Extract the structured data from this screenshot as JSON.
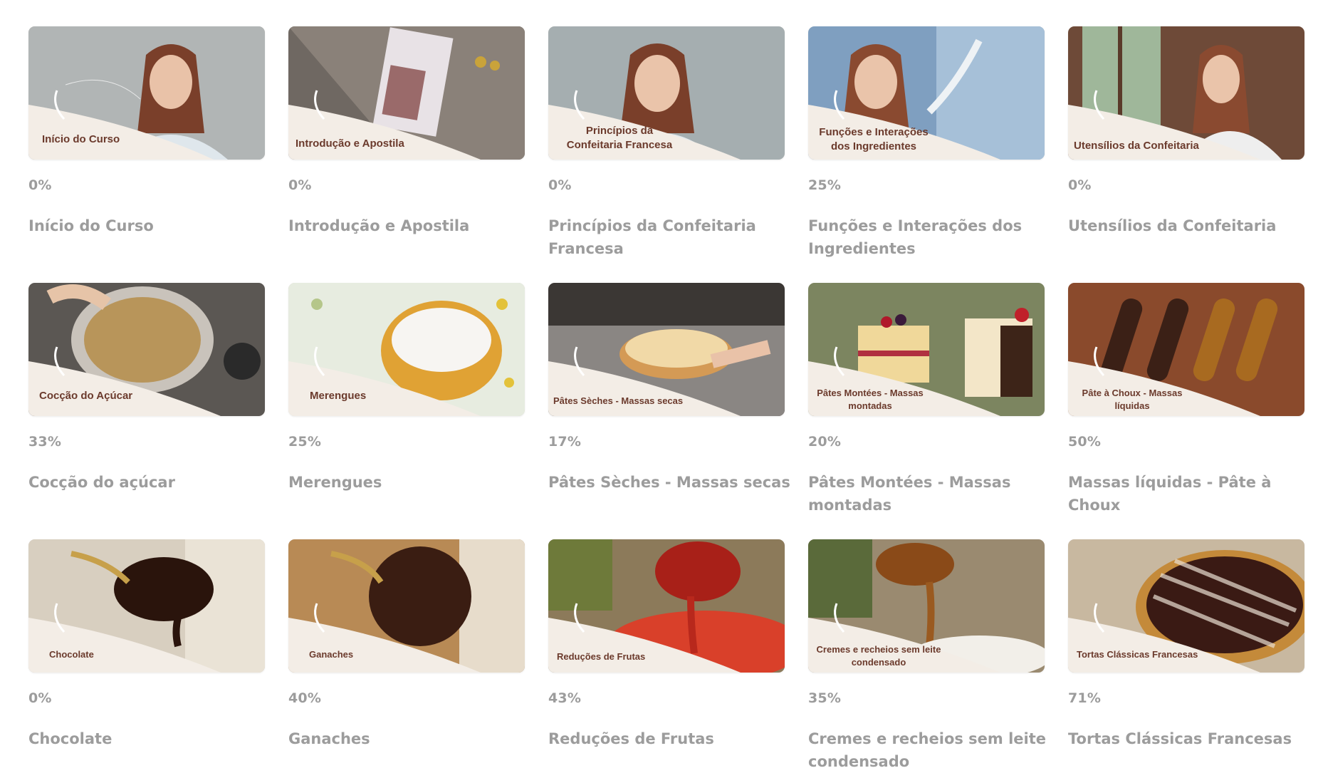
{
  "cards": [
    {
      "thumb_label": "Início do Curso",
      "percent": "0%",
      "title": "Início do Curso",
      "scene": "portrait-chef"
    },
    {
      "thumb_label": "Introdução e Apostila",
      "percent": "0%",
      "title": "Introdução e Apostila",
      "scene": "book"
    },
    {
      "thumb_label": "Princípios da\nConfeitaria Francesa",
      "percent": "0%",
      "title": "Princípios da Confeitaria Francesa",
      "scene": "portrait-chef"
    },
    {
      "thumb_label": "Funções e Interações\ndos Ingredientes",
      "percent": "25%",
      "title": "Funções e Interações dos Ingredientes",
      "scene": "chef-flour"
    },
    {
      "thumb_label": "Utensílios da Confeitaria",
      "percent": "0%",
      "title": "Utensílios da Confeitaria",
      "scene": "chef-window"
    },
    {
      "thumb_label": "Cocção do Açúcar",
      "percent": "33%",
      "title": "Cocção do açúcar",
      "scene": "sugar-pot"
    },
    {
      "thumb_label": "Merengues",
      "percent": "25%",
      "title": "Merengues",
      "scene": "meringues"
    },
    {
      "thumb_label": "Pâtes Sèches - Massas secas",
      "percent": "17%",
      "title": "Pâtes Sèches - Massas secas",
      "scene": "tart-dough"
    },
    {
      "thumb_label": "Pâtes Montées - Massas\nmontadas",
      "percent": "20%",
      "title": "Pâtes Montées - Massas montadas",
      "scene": "layer-cake"
    },
    {
      "thumb_label": "Pâte à Choux - Massas\nlíquidas",
      "percent": "50%",
      "title": "Massas líquidas - Pâte à Choux",
      "scene": "eclairs"
    },
    {
      "thumb_label": "Chocolate",
      "percent": "0%",
      "title": "Chocolate",
      "scene": "chocolate-spoon"
    },
    {
      "thumb_label": "Ganaches",
      "percent": "40%",
      "title": "Ganaches",
      "scene": "ganache"
    },
    {
      "thumb_label": "Reduções de Frutas",
      "percent": "43%",
      "title": "Reduções de Frutas",
      "scene": "fruit-reduction"
    },
    {
      "thumb_label": "Cremes e recheios sem leite\ncondensado",
      "percent": "35%",
      "title": "Cremes e recheios sem leite condensado",
      "scene": "caramel-spoon"
    },
    {
      "thumb_label": "Tortas Clássicas Francesas",
      "percent": "71%",
      "title": "Tortas Clássicas Francesas",
      "scene": "lattice-tart"
    }
  ],
  "colors": {
    "text_muted": "#9c9c9c",
    "label_brown": "#6b3a2c",
    "banner_cream": "#f3ede6"
  }
}
